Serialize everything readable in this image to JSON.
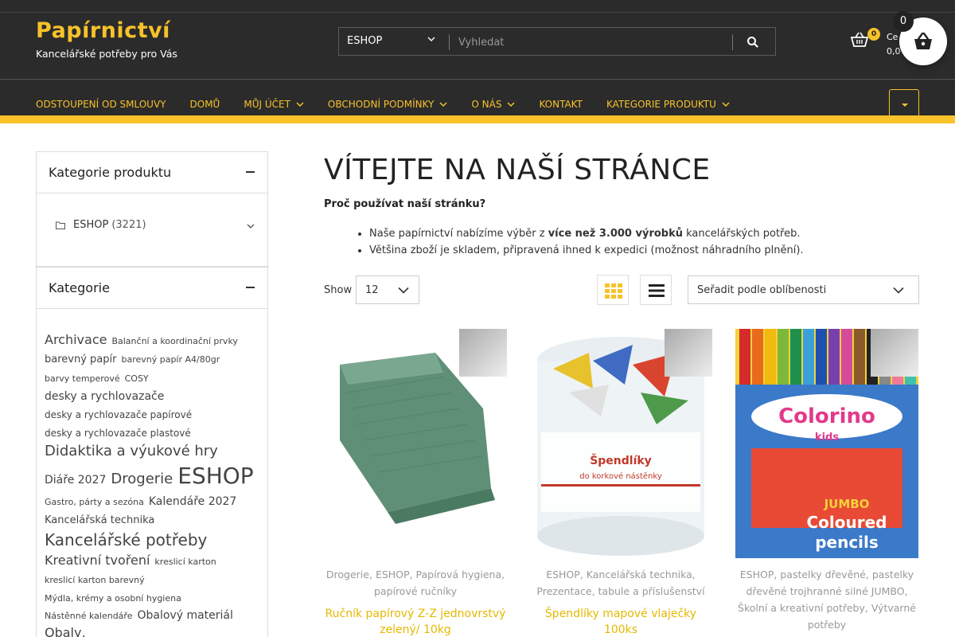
{
  "header": {
    "brand_title": "Papírnictví",
    "brand_subtitle": "Kancelářské potřeby pro Vás",
    "search_category": "ESHOP",
    "search_placeholder": "Vyhledat",
    "cart_count": "0",
    "cart_label": "Ce",
    "cart_total": "0,0",
    "floating_cart_count": "0",
    "accent_color": "#f7c22a",
    "bg_color": "#2b2b2b"
  },
  "nav": {
    "items": [
      {
        "label": "ODSTOUPENÍ OD SMLOUVY",
        "has_dropdown": false
      },
      {
        "label": "DOMŮ",
        "has_dropdown": false
      },
      {
        "label": "MŮJ ÚČET",
        "has_dropdown": true
      },
      {
        "label": "OBCHODNÍ PODMÍNKY",
        "has_dropdown": true
      },
      {
        "label": "O NÁS",
        "has_dropdown": true
      },
      {
        "label": "KONTAKT",
        "has_dropdown": false
      },
      {
        "label": "KATEGORIE PRODUKTU",
        "has_dropdown": true
      }
    ]
  },
  "sidebar": {
    "product_categories": {
      "title": "Kategorie produktu",
      "items": [
        {
          "label": "ESHOP",
          "count": "(3221)"
        }
      ]
    },
    "categories": {
      "title": "Kategorie",
      "tags": [
        {
          "label": "Archivace",
          "size": 5
        },
        {
          "label": "Balanční a koordinační prvky",
          "size": 1
        },
        {
          "label": "barevný papír",
          "size": 3
        },
        {
          "label": "barevný papír A4/80gr",
          "size": 1
        },
        {
          "label": "barvy temperové",
          "size": 1
        },
        {
          "label": "COSY",
          "size": 1
        },
        {
          "label": "desky a rychlovazače",
          "size": 4
        },
        {
          "label": "desky a rychlovazače papírové",
          "size": 2
        },
        {
          "label": "desky a rychlovazače plastové",
          "size": 2
        },
        {
          "label": "Didaktika a výukové hry",
          "size": 6
        },
        {
          "label": "Diáře 2027",
          "size": 4
        },
        {
          "label": "Drogerie",
          "size": 6
        },
        {
          "label": "ESHOP",
          "size": 8
        },
        {
          "label": "Gastro, párty a sezóna",
          "size": 1
        },
        {
          "label": "Kalendáře 2027",
          "size": 4
        },
        {
          "label": "Kancelářská technika",
          "size": 3
        },
        {
          "label": "Kancelářské potřeby",
          "size": 7
        },
        {
          "label": "Kreativní tvoření",
          "size": 5
        },
        {
          "label": "kreslicí karton",
          "size": 1
        },
        {
          "label": "kreslicí karton barevný",
          "size": 1
        },
        {
          "label": "Mýdla, krémy a osobní hygiena",
          "size": 1
        },
        {
          "label": "Nástěnné kalendáře",
          "size": 1
        },
        {
          "label": "Obalový materiál",
          "size": 4
        },
        {
          "label": "Obaly,",
          "size": 5
        }
      ]
    }
  },
  "main": {
    "title": "VÍTEJTE NA NAŠÍ STRÁNCE",
    "question": "Proč používat naší stránku?",
    "bullet1_pre": "Naše papírnictví nabízíme výběr z ",
    "bullet1_bold": "více než 3.000 výrobků",
    "bullet1_post": " kancelářských potřeb.",
    "bullet2": "Většina zboží je skladem, připravená ihned k expedici (možnost náhradního plnění).",
    "show_label": "Show",
    "show_value": "12",
    "sort_value": "Seřadit podle oblíbenosti"
  },
  "products": [
    {
      "categories": [
        "Drogerie",
        "ESHOP",
        "Papírová hygiena",
        "papírové ručníky"
      ],
      "name": "Ručník papírový Z-Z jednovrstvý zelený/ 10kg"
    },
    {
      "categories": [
        "ESHOP",
        "Kancelářská technika",
        "Prezentace",
        "tabule a příslušenství"
      ],
      "name": "Špendlíky mapové vlaječky 100ks"
    },
    {
      "categories": [
        "ESHOP",
        "pastelky dřevěné",
        "pastelky dřevěné trojhranné silné JUMBO",
        "Školní a kreativní potřeby",
        "Výtvarné potřeby"
      ],
      "name": ""
    }
  ]
}
